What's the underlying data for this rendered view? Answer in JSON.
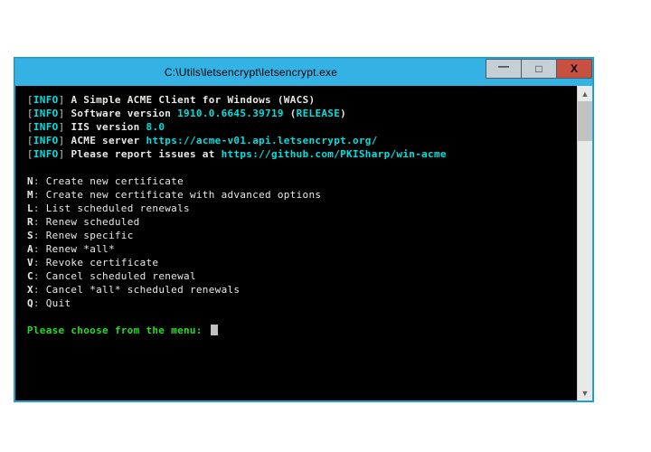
{
  "window": {
    "title": "C:\\Utils\\letsencrypt\\letsencrypt.exe",
    "controls": {
      "minimize_glyph": "—",
      "maximize_glyph": "□",
      "close_glyph": "X"
    }
  },
  "colors": {
    "titlebar": "#34b2e4",
    "console_bg": "#000000",
    "cyan": "#00e0e0",
    "green": "#20e020",
    "close_btn": "#c85040"
  },
  "console": {
    "info_label": "INFO",
    "info_lines": [
      {
        "pre": " ",
        "text": "A Simple ACME Client for Windows (WACS)"
      },
      {
        "pre": " ",
        "text": "Software version ",
        "highlight": "1910.0.6645.39719",
        "mid": " (",
        "highlight2": "RELEASE",
        "post": ")"
      },
      {
        "pre": " ",
        "text": "IIS version ",
        "highlight": "8.0"
      },
      {
        "pre": " ",
        "text": "ACME server ",
        "highlight": "https://acme-v01.api.letsencrypt.org/"
      },
      {
        "pre": " ",
        "text": "Please report issues at ",
        "highlight": "https://github.com/PKISharp/win-acme"
      }
    ],
    "menu": [
      {
        "key": "N",
        "label": "Create new certificate"
      },
      {
        "key": "M",
        "label": "Create new certificate with advanced options"
      },
      {
        "key": "L",
        "label": "List scheduled renewals"
      },
      {
        "key": "R",
        "label": "Renew scheduled"
      },
      {
        "key": "S",
        "label": "Renew specific"
      },
      {
        "key": "A",
        "label": "Renew *all*"
      },
      {
        "key": "V",
        "label": "Revoke certificate"
      },
      {
        "key": "C",
        "label": "Cancel scheduled renewal"
      },
      {
        "key": "X",
        "label": "Cancel *all* scheduled renewals"
      },
      {
        "key": "Q",
        "label": "Quit"
      }
    ],
    "prompt": " Please choose from the menu: "
  },
  "scrollbar": {
    "up_glyph": "▲",
    "down_glyph": "▼"
  }
}
